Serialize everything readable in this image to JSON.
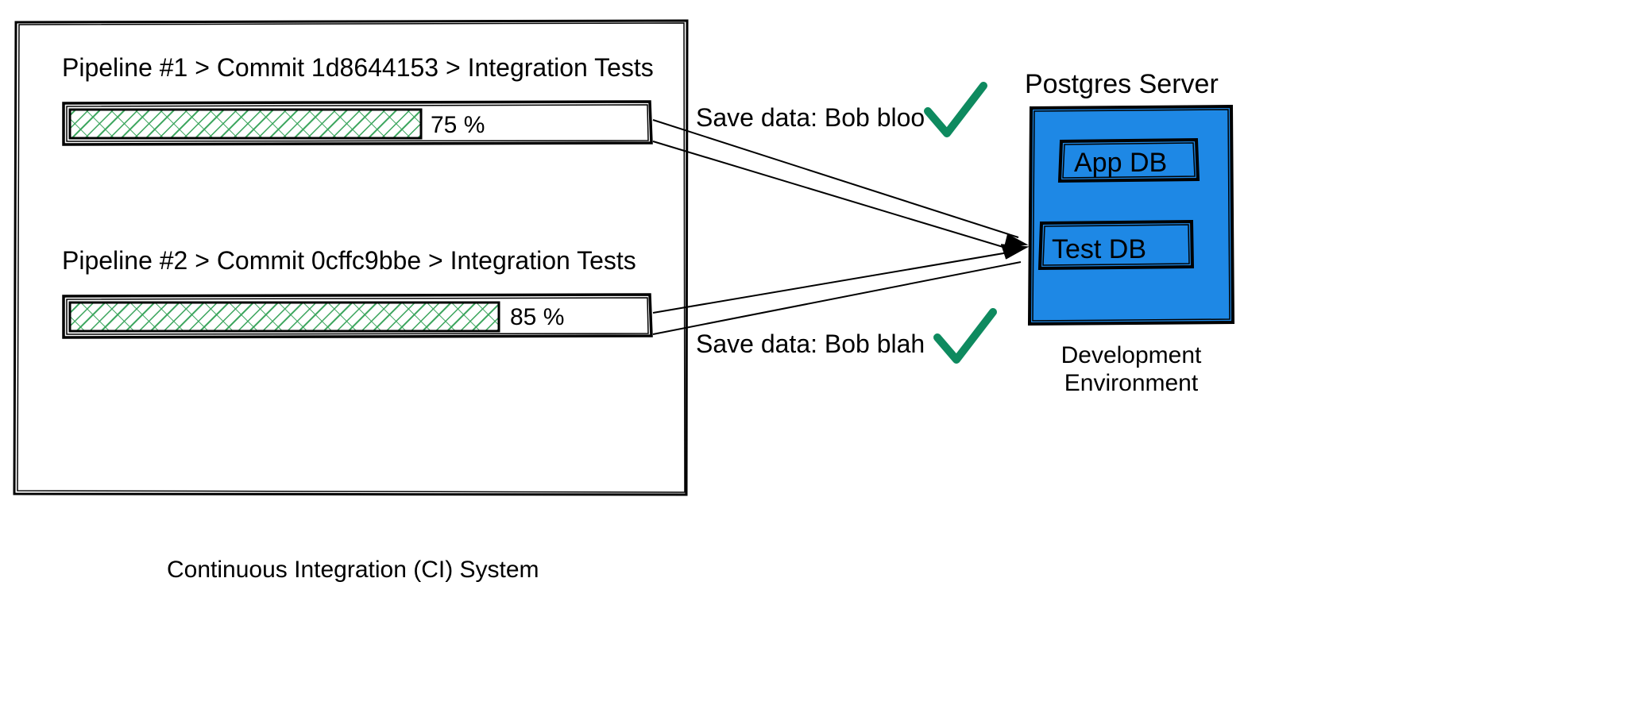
{
  "ci": {
    "label": "Continuous Integration (CI) System",
    "pipelines": [
      {
        "breadcrumb": "Pipeline #1 > Commit 1d8644153 > Integration Tests",
        "progress_label": "75 %",
        "progress": 75
      },
      {
        "breadcrumb": "Pipeline #2 > Commit 0cffc9bbe > Integration Tests",
        "progress_label": "85 %",
        "progress": 85
      }
    ]
  },
  "actions": [
    {
      "label": "Save data: Bob bloo"
    },
    {
      "label": "Save data: Bob blah"
    }
  ],
  "server": {
    "title": "Postgres Server",
    "subtitle": "Development\nEnvironment",
    "dbs": [
      "App DB",
      "Test DB"
    ]
  },
  "colors": {
    "server_fill": "#1E88E5",
    "check": "#0E8A5F",
    "hatch": "#3BA55D"
  }
}
